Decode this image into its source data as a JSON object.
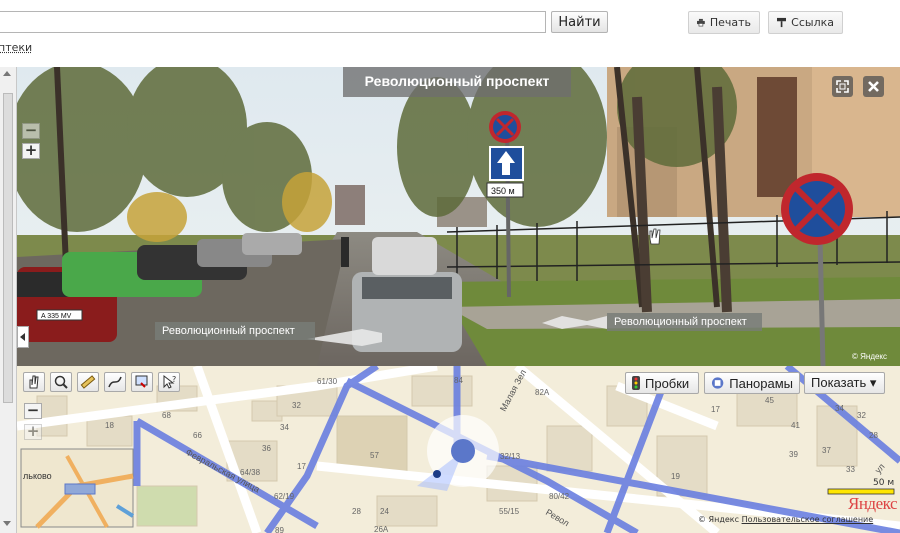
{
  "search": {
    "value": "",
    "button_label": "Найти"
  },
  "toolbar": {
    "print_label": "Печать",
    "link_label": "Ссылка"
  },
  "breadcrumb": "птеки",
  "panorama": {
    "title": "Революционный проспект",
    "street_label_left": "Революционный проспект",
    "street_label_right": "Революционный проспект",
    "sign_plate": "350 м",
    "plate_text": "A 335 MV",
    "watermark": "© Яндекс"
  },
  "map": {
    "buttons": {
      "traffic": "Пробки",
      "panoramas": "Панорамы",
      "show": "Показать ▾"
    },
    "minimap_label": "льково",
    "scale": "50 м",
    "logo": "Яндекс",
    "copyright": "© Яндекс",
    "agreement": "Пользовательское соглашение",
    "streets": [
      "Февральская улица",
      "Малая Зел",
      "Револ",
      "ул"
    ],
    "house_numbers": [
      "61/30",
      "84",
      "82A",
      "32",
      "68",
      "18",
      "66",
      "34",
      "36",
      "57",
      "32/13",
      "17",
      "45",
      "34",
      "41",
      "32",
      "28",
      "39",
      "37",
      "33",
      "64/38",
      "17",
      "62/19",
      "28",
      "24",
      "26A",
      "55/15",
      "80/42",
      "19",
      "89"
    ]
  }
}
